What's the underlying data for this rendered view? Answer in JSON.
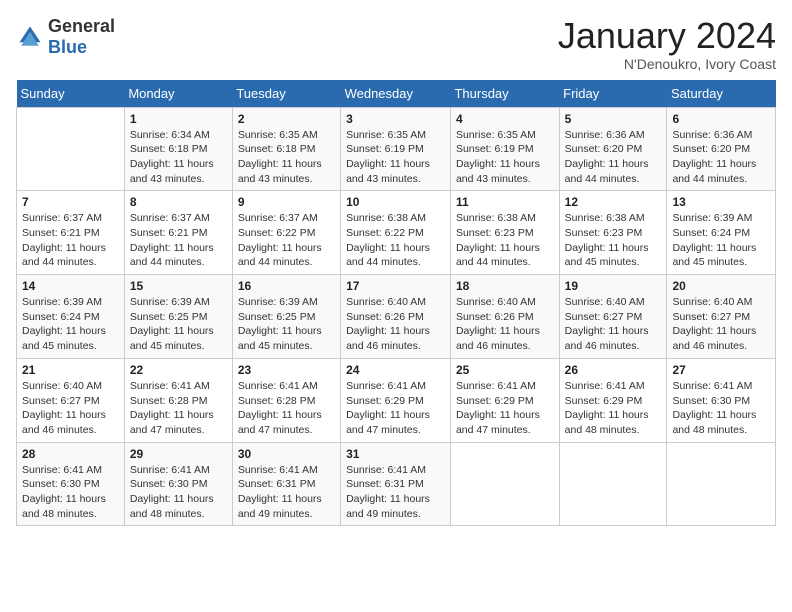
{
  "logo": {
    "general": "General",
    "blue": "Blue"
  },
  "header": {
    "month": "January 2024",
    "location": "N'Denoukro, Ivory Coast"
  },
  "weekdays": [
    "Sunday",
    "Monday",
    "Tuesday",
    "Wednesday",
    "Thursday",
    "Friday",
    "Saturday"
  ],
  "weeks": [
    [
      {
        "day": "",
        "info": ""
      },
      {
        "day": "1",
        "info": "Sunrise: 6:34 AM\nSunset: 6:18 PM\nDaylight: 11 hours\nand 43 minutes."
      },
      {
        "day": "2",
        "info": "Sunrise: 6:35 AM\nSunset: 6:18 PM\nDaylight: 11 hours\nand 43 minutes."
      },
      {
        "day": "3",
        "info": "Sunrise: 6:35 AM\nSunset: 6:19 PM\nDaylight: 11 hours\nand 43 minutes."
      },
      {
        "day": "4",
        "info": "Sunrise: 6:35 AM\nSunset: 6:19 PM\nDaylight: 11 hours\nand 43 minutes."
      },
      {
        "day": "5",
        "info": "Sunrise: 6:36 AM\nSunset: 6:20 PM\nDaylight: 11 hours\nand 44 minutes."
      },
      {
        "day": "6",
        "info": "Sunrise: 6:36 AM\nSunset: 6:20 PM\nDaylight: 11 hours\nand 44 minutes."
      }
    ],
    [
      {
        "day": "7",
        "info": "Sunrise: 6:37 AM\nSunset: 6:21 PM\nDaylight: 11 hours\nand 44 minutes."
      },
      {
        "day": "8",
        "info": "Sunrise: 6:37 AM\nSunset: 6:21 PM\nDaylight: 11 hours\nand 44 minutes."
      },
      {
        "day": "9",
        "info": "Sunrise: 6:37 AM\nSunset: 6:22 PM\nDaylight: 11 hours\nand 44 minutes."
      },
      {
        "day": "10",
        "info": "Sunrise: 6:38 AM\nSunset: 6:22 PM\nDaylight: 11 hours\nand 44 minutes."
      },
      {
        "day": "11",
        "info": "Sunrise: 6:38 AM\nSunset: 6:23 PM\nDaylight: 11 hours\nand 44 minutes."
      },
      {
        "day": "12",
        "info": "Sunrise: 6:38 AM\nSunset: 6:23 PM\nDaylight: 11 hours\nand 45 minutes."
      },
      {
        "day": "13",
        "info": "Sunrise: 6:39 AM\nSunset: 6:24 PM\nDaylight: 11 hours\nand 45 minutes."
      }
    ],
    [
      {
        "day": "14",
        "info": "Sunrise: 6:39 AM\nSunset: 6:24 PM\nDaylight: 11 hours\nand 45 minutes."
      },
      {
        "day": "15",
        "info": "Sunrise: 6:39 AM\nSunset: 6:25 PM\nDaylight: 11 hours\nand 45 minutes."
      },
      {
        "day": "16",
        "info": "Sunrise: 6:39 AM\nSunset: 6:25 PM\nDaylight: 11 hours\nand 45 minutes."
      },
      {
        "day": "17",
        "info": "Sunrise: 6:40 AM\nSunset: 6:26 PM\nDaylight: 11 hours\nand 46 minutes."
      },
      {
        "day": "18",
        "info": "Sunrise: 6:40 AM\nSunset: 6:26 PM\nDaylight: 11 hours\nand 46 minutes."
      },
      {
        "day": "19",
        "info": "Sunrise: 6:40 AM\nSunset: 6:27 PM\nDaylight: 11 hours\nand 46 minutes."
      },
      {
        "day": "20",
        "info": "Sunrise: 6:40 AM\nSunset: 6:27 PM\nDaylight: 11 hours\nand 46 minutes."
      }
    ],
    [
      {
        "day": "21",
        "info": "Sunrise: 6:40 AM\nSunset: 6:27 PM\nDaylight: 11 hours\nand 46 minutes."
      },
      {
        "day": "22",
        "info": "Sunrise: 6:41 AM\nSunset: 6:28 PM\nDaylight: 11 hours\nand 47 minutes."
      },
      {
        "day": "23",
        "info": "Sunrise: 6:41 AM\nSunset: 6:28 PM\nDaylight: 11 hours\nand 47 minutes."
      },
      {
        "day": "24",
        "info": "Sunrise: 6:41 AM\nSunset: 6:29 PM\nDaylight: 11 hours\nand 47 minutes."
      },
      {
        "day": "25",
        "info": "Sunrise: 6:41 AM\nSunset: 6:29 PM\nDaylight: 11 hours\nand 47 minutes."
      },
      {
        "day": "26",
        "info": "Sunrise: 6:41 AM\nSunset: 6:29 PM\nDaylight: 11 hours\nand 48 minutes."
      },
      {
        "day": "27",
        "info": "Sunrise: 6:41 AM\nSunset: 6:30 PM\nDaylight: 11 hours\nand 48 minutes."
      }
    ],
    [
      {
        "day": "28",
        "info": "Sunrise: 6:41 AM\nSunset: 6:30 PM\nDaylight: 11 hours\nand 48 minutes."
      },
      {
        "day": "29",
        "info": "Sunrise: 6:41 AM\nSunset: 6:30 PM\nDaylight: 11 hours\nand 48 minutes."
      },
      {
        "day": "30",
        "info": "Sunrise: 6:41 AM\nSunset: 6:31 PM\nDaylight: 11 hours\nand 49 minutes."
      },
      {
        "day": "31",
        "info": "Sunrise: 6:41 AM\nSunset: 6:31 PM\nDaylight: 11 hours\nand 49 minutes."
      },
      {
        "day": "",
        "info": ""
      },
      {
        "day": "",
        "info": ""
      },
      {
        "day": "",
        "info": ""
      }
    ]
  ]
}
